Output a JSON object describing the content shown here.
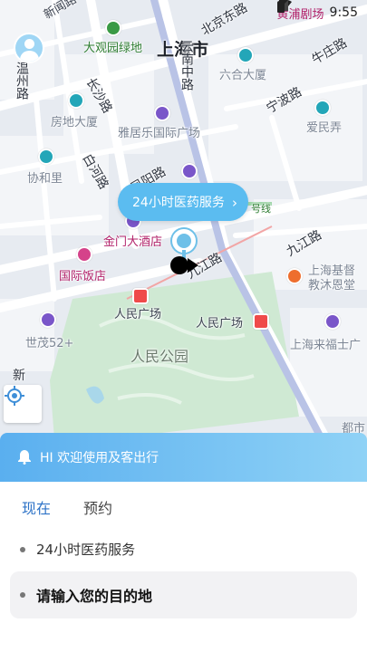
{
  "status_bar": {
    "time": "9:55",
    "map_edge_text": "黄浦剧场"
  },
  "map": {
    "city_label": "上海市",
    "labels": {
      "xinwen": "新闻路",
      "daguanyuan": "大观园绿地",
      "beijingdong": "北京东路",
      "niuzhuang": "牛庄路",
      "liuhe": "六合大厦",
      "changsha": "长沙路",
      "yunnan": "云南中路",
      "fangdi": "房地大厦",
      "yalefeng": "雅居乐国际广场",
      "ningbo": "宁波路",
      "aimin": "爱民弄",
      "xiehe": "协和里",
      "baihe": "白河路",
      "fengyang": "凤阳路",
      "jinmen": "金门大酒店",
      "line_tag": "号线",
      "jiujiang": "九江路",
      "jiujiang2": "九江路",
      "guoji": "国际饭店",
      "shanghai_church": "上海基督教沐恩堂",
      "renmin_sq1": "人民广场",
      "renmin_sq2": "人民广场",
      "shimao": "世茂52+",
      "raffles": "上海来福士广",
      "renmin_park": "人民公园",
      "xin": "新",
      "dushi": "都市",
      "zhenbei": "温州路"
    }
  },
  "service_bubble": {
    "label": "24小时医药服务",
    "chevron": "›"
  },
  "banner": {
    "text": "HI 欢迎使用及客出行"
  },
  "tabs": [
    {
      "label": "现在",
      "active": true
    },
    {
      "label": "预约",
      "active": false
    }
  ],
  "suggestion": {
    "label": "24小时医药服务"
  },
  "destination": {
    "placeholder": "请输入您的目的地"
  }
}
